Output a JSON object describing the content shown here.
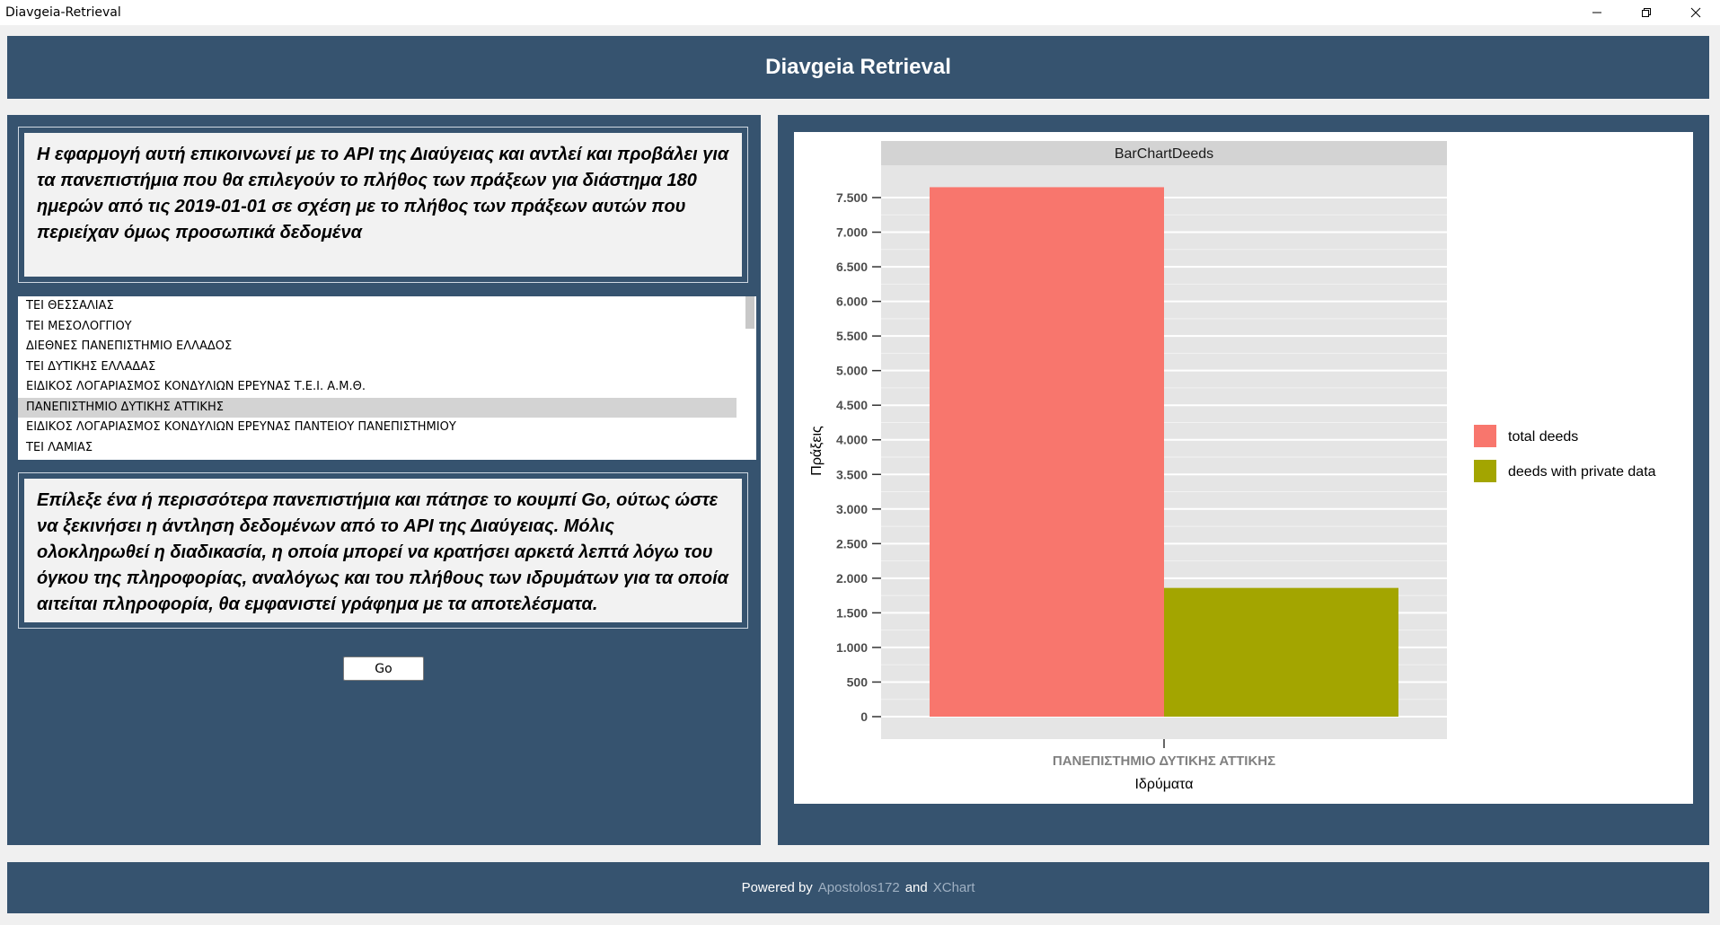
{
  "window": {
    "title": "Diavgeia-Retrieval",
    "controls": [
      "minimize-icon",
      "restore-icon",
      "close-icon"
    ]
  },
  "header": {
    "title": "Diavgeia Retrieval",
    "background": "#36536f"
  },
  "info": {
    "text": "Η εφαρμογή αυτή επικοινωνεί με το API της Διαύγειας και αντλεί και προβάλει για τα πανεπιστήμια που θα επιλεγούν το πλήθος των πράξεων για διάστημα 180 ημερών από τις 2019-01-01 σε σχέση με το πλήθος των πράξεων αυτών που περιείχαν όμως προσωπικά δεδομένα"
  },
  "institutions": {
    "items": [
      "ΤΕΙ ΘΕΣΣΑΛΙΑΣ",
      "ΤΕΙ ΜΕΣΟΛΟΓΓΙΟΥ",
      "ΔΙΕΘΝΕΣ ΠΑΝΕΠΙΣΤΗΜΙΟ ΕΛΛΑΔΟΣ",
      "ΤΕΙ ΔΥΤΙΚΗΣ ΕΛΛΑΔΑΣ",
      "ΕΙΔΙΚΟΣ ΛΟΓΑΡΙΑΣΜΟΣ ΚΟΝΔΥΛΙΩΝ ΕΡΕΥΝΑΣ Τ.Ε.Ι. Α.Μ.Θ.",
      "ΠΑΝΕΠΙΣΤΗΜΙΟ ΔΥΤΙΚΗΣ ΑΤΤΙΚΗΣ",
      "ΕΙΔΙΚΟΣ ΛΟΓΑΡΙΑΣΜΟΣ ΚΟΝΔΥΛΙΩΝ  ΕΡΕΥΝΑΣ ΠΑΝΤΕΙΟΥ ΠΑΝΕΠΙΣΤΗΜΙΟΥ",
      "ΤΕΙ ΛΑΜΙΑΣ"
    ],
    "selected": "ΠΑΝΕΠΙΣΤΗΜΙΟ ΔΥΤΙΚΗΣ ΑΤΤΙΚΗΣ"
  },
  "instructions": {
    "text": "Επίλεξε ένα ή περισσότερα πανεπιστήμια και πάτησε το κουμπί Go, ούτως ώστε να ξεκινήσει η άντληση δεδομένων από το API της Διαύγειας. Μόλις ολοκληρωθεί η διαδικασία, η οποία μπορεί να κρατήσει αρκετά λεπτά λόγω του όγκου της πληροφορίας, αναλόγως και του πλήθους των ιδρυμάτων για τα οποία αιτείται πληροφορία, θα εμφανιστεί γράφημα με τα αποτελέσματα."
  },
  "go_button": {
    "label": "Go"
  },
  "chart_data": {
    "type": "bar",
    "title": "BarChartDeeds",
    "xlabel": "Ιδρύματα",
    "ylabel": "Πράξεις",
    "categories": [
      "ΠΑΝΕΠΙΣΤΗΜΙΟ ΔΥΤΙΚΗΣ ΑΤΤΙΚΗΣ"
    ],
    "series": [
      {
        "name": "total deeds",
        "values": [
          7650
        ],
        "color": "#f8766d"
      },
      {
        "name": "deeds with private data",
        "values": [
          1860
        ],
        "color": "#a3a500"
      }
    ],
    "ylim": [
      0,
      7500
    ],
    "yticks": [
      0,
      500,
      1000,
      1500,
      2000,
      2500,
      3000,
      3500,
      4000,
      4500,
      5000,
      5500,
      6000,
      6500,
      7000,
      7500
    ],
    "ytick_labels": [
      "0",
      "500",
      "1.000",
      "1.500",
      "2.000",
      "2.500",
      "3.000",
      "3.500",
      "4.000",
      "4.500",
      "5.000",
      "5.500",
      "6.000",
      "6.500",
      "7.000",
      "7.500"
    ],
    "grid": true,
    "legend_position": "right",
    "plot_background": "#e5e5e5"
  },
  "footer": {
    "powered": "Powered by",
    "author": "Apostolos172",
    "and": "and",
    "library": "XChart"
  }
}
